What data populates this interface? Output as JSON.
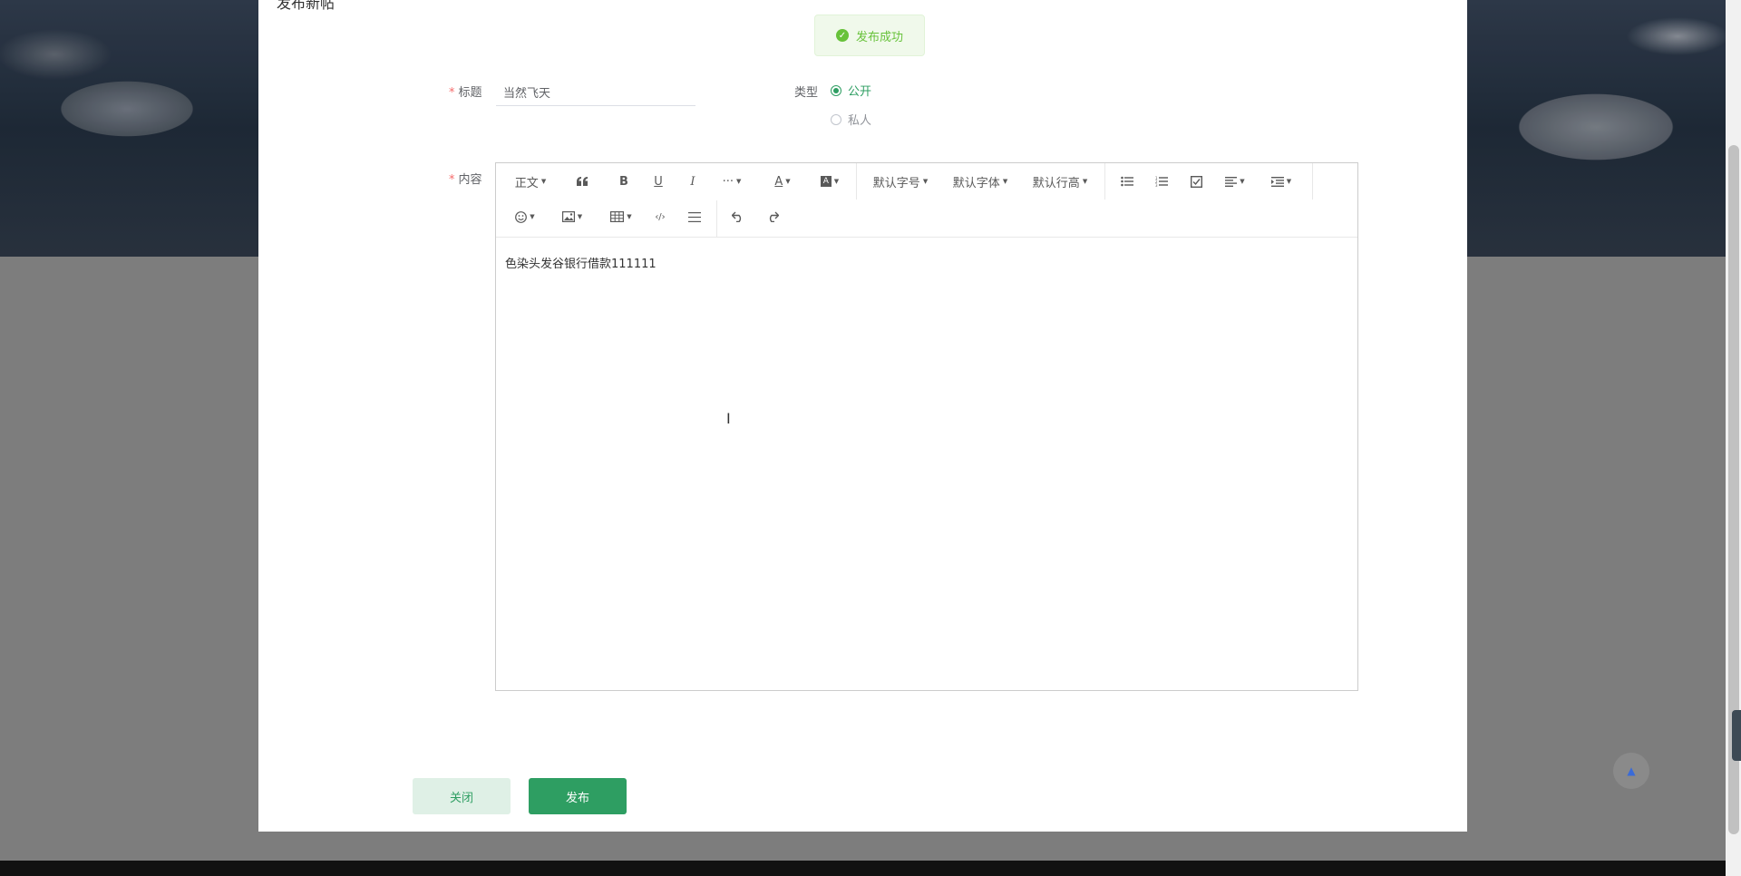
{
  "modal": {
    "title": "发布新帖"
  },
  "toast": {
    "text": "发布成功"
  },
  "form": {
    "title_label": "标题",
    "title_value": "当然飞天",
    "type_label": "类型",
    "type_options": [
      "公开",
      "私人"
    ],
    "content_label": "内容"
  },
  "toolbar": {
    "paragraph": "正文",
    "font_size": "默认字号",
    "font_family": "默认字体",
    "line_height": "默认行高"
  },
  "editor": {
    "content": "色染头发谷银行借款111111"
  },
  "buttons": {
    "close": "关闭",
    "publish": "发布"
  },
  "colors": {
    "accent": "#2e9e62",
    "success": "#67c23a"
  }
}
